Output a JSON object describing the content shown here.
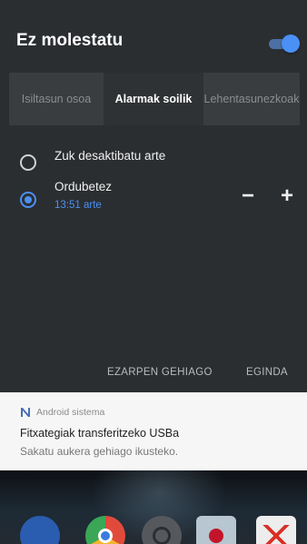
{
  "dnd": {
    "title": "Ez molestatu",
    "toggle_on": true,
    "accent_color": "#4a90f5",
    "modes": [
      {
        "label": "Isiltasun osoa",
        "selected": false
      },
      {
        "label": "Alarmak soilik",
        "selected": true
      },
      {
        "label": "Lehentasunezkoak",
        "selected": false
      }
    ],
    "options": {
      "until_off": {
        "label": "Zuk desaktibatu arte",
        "selected": false
      },
      "for_hours": {
        "label": "Ordubetez",
        "sub": "13:51 arte",
        "selected": true,
        "decrease_label": "−",
        "increase_label": "+"
      }
    },
    "actions": {
      "more_settings": "EZARPEN GEHIAGO",
      "done": "EGINDA"
    }
  },
  "notification": {
    "app_icon": "android-n-icon",
    "app_name": "Android sistema",
    "title": "Fitxategiak transferitzeko USBa",
    "text": "Sakatu aukera gehiago ikusteko."
  },
  "dock": {
    "icons": [
      "phone-icon",
      "chrome-icon",
      "camera-icon",
      "photos-icon",
      "gmail-icon"
    ]
  }
}
